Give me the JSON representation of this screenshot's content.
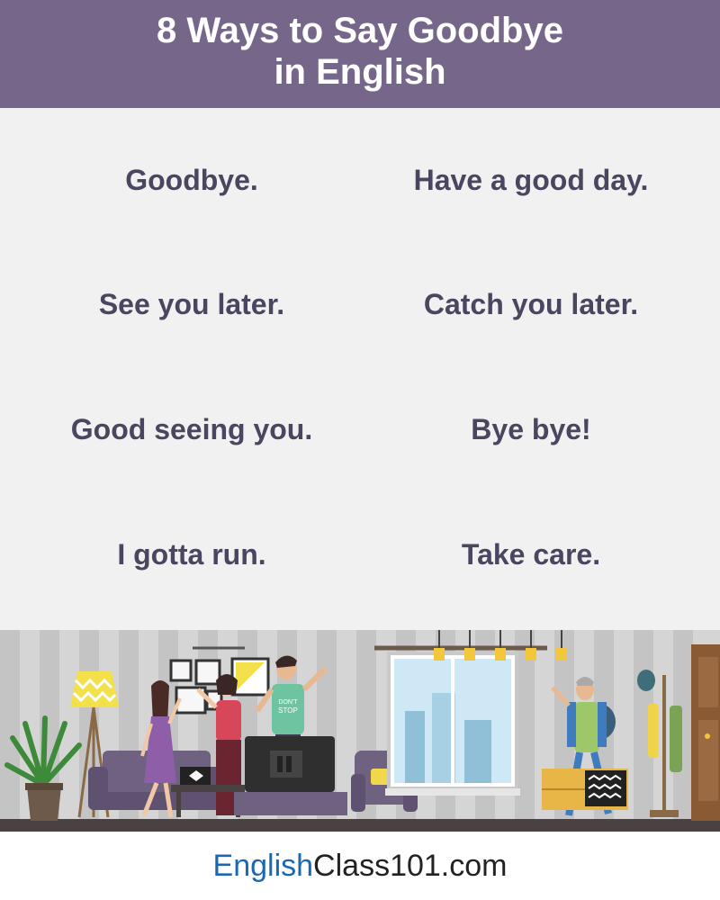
{
  "header": {
    "title_line1": "8 Ways to Say Goodbye",
    "title_line2": "in English"
  },
  "phrases": [
    "Goodbye.",
    "Have a good day.",
    "See you later.",
    "Catch you later.",
    "Good seeing you.",
    "Bye bye!",
    "I gotta run.",
    "Take care."
  ],
  "illustration": {
    "tshirt_text_line1": "DON'T",
    "tshirt_text_line2": "STOP"
  },
  "footer": {
    "brand_part1": "English",
    "brand_part2": "Class101.com"
  },
  "colors": {
    "header_bg": "#76678a",
    "phrase_text": "#4b4660",
    "background": "#f1f1f1",
    "brand_blue": "#1a68b5"
  }
}
